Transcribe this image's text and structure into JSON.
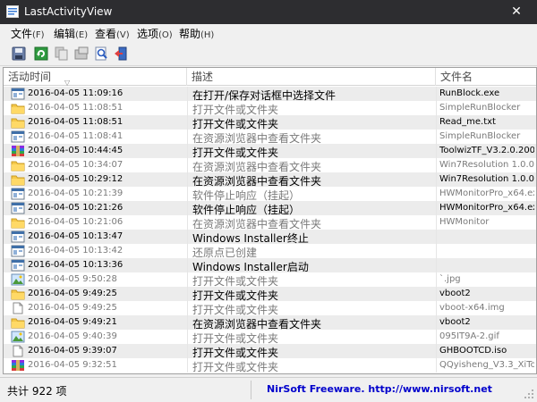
{
  "window": {
    "title": "LastActivityView",
    "close": "✕"
  },
  "menu": [
    {
      "label": "文件",
      "acc": "(F)"
    },
    {
      "label": "编辑",
      "acc": "(E)"
    },
    {
      "label": "查看",
      "acc": "(V)"
    },
    {
      "label": "选项",
      "acc": "(O)"
    },
    {
      "label": "帮助",
      "acc": "(H)"
    }
  ],
  "toolbar": {
    "buttons": [
      "save-icon",
      "refresh-icon",
      "copy-icon",
      "properties-icon",
      "find-icon",
      "exit-icon"
    ]
  },
  "columns": [
    "活动时间",
    "描述",
    "文件名"
  ],
  "rows": [
    {
      "icon": "window-icon",
      "time": "2016-04-05 11:09:16",
      "desc": "在打开/保存对话框中选择文件",
      "file": "RunBlock.exe",
      "bold": true
    },
    {
      "icon": "folder-icon",
      "time": "2016-04-05 11:08:51",
      "desc": "打开文件或文件夹",
      "file": "SimpleRunBlocker",
      "bold": false
    },
    {
      "icon": "folder-icon",
      "time": "2016-04-05 11:08:51",
      "desc": "打开文件或文件夹",
      "file": "Read_me.txt",
      "bold": true
    },
    {
      "icon": "window-icon",
      "time": "2016-04-05 11:08:41",
      "desc": "在资源浏览器中查看文件夹",
      "file": "SimpleRunBlocker",
      "bold": false
    },
    {
      "icon": "archive-icon",
      "time": "2016-04-05 10:44:45",
      "desc": "打开文件或文件夹",
      "file": "ToolwizTF_V3.2.0.200",
      "bold": true
    },
    {
      "icon": "folder-icon",
      "time": "2016-04-05 10:34:07",
      "desc": "在资源浏览器中查看文件夹",
      "file": "Win7Resolution 1.0.0",
      "bold": false
    },
    {
      "icon": "folder-icon",
      "time": "2016-04-05 10:29:12",
      "desc": "在资源浏览器中查看文件夹",
      "file": "Win7Resolution 1.0.0",
      "bold": true
    },
    {
      "icon": "window-icon",
      "time": "2016-04-05 10:21:39",
      "desc": "软件停止响应（挂起）",
      "file": "HWMonitorPro_x64.exe",
      "bold": false
    },
    {
      "icon": "window-icon",
      "time": "2016-04-05 10:21:26",
      "desc": "软件停止响应（挂起）",
      "file": "HWMonitorPro_x64.exe",
      "bold": true
    },
    {
      "icon": "folder-icon",
      "time": "2016-04-05 10:21:06",
      "desc": "在资源浏览器中查看文件夹",
      "file": "HWMonitor",
      "bold": false
    },
    {
      "icon": "window-icon",
      "time": "2016-04-05 10:13:47",
      "desc": "Windows Installer终止",
      "file": "",
      "bold": true
    },
    {
      "icon": "window-icon",
      "time": "2016-04-05 10:13:42",
      "desc": "还原点已创建",
      "file": "",
      "bold": false
    },
    {
      "icon": "window-icon",
      "time": "2016-04-05 10:13:36",
      "desc": "Windows Installer启动",
      "file": "",
      "bold": true
    },
    {
      "icon": "image-icon",
      "time": "2016-04-05 9:50:28",
      "desc": "打开文件或文件夹",
      "file": "`.jpg",
      "bold": false
    },
    {
      "icon": "folder-icon",
      "time": "2016-04-05 9:49:25",
      "desc": "打开文件或文件夹",
      "file": "vboot2",
      "bold": true
    },
    {
      "icon": "file-icon",
      "time": "2016-04-05 9:49:25",
      "desc": "打开文件或文件夹",
      "file": "vboot-x64.img",
      "bold": false
    },
    {
      "icon": "folder-icon",
      "time": "2016-04-05 9:49:21",
      "desc": "在资源浏览器中查看文件夹",
      "file": "vboot2",
      "bold": true
    },
    {
      "icon": "image-icon",
      "time": "2016-04-05 9:40:39",
      "desc": "打开文件或文件夹",
      "file": "095IT9A-2.gif",
      "bold": false
    },
    {
      "icon": "file-icon",
      "time": "2016-04-05 9:39:07",
      "desc": "打开文件或文件夹",
      "file": "GHBOOTCD.iso",
      "bold": true
    },
    {
      "icon": "archive-icon",
      "time": "2016-04-05 9:32:51",
      "desc": "打开文件或文件夹",
      "file": "QQyisheng_V3.3_XiTo",
      "bold": false
    }
  ],
  "status": {
    "count": "共计 922 项",
    "link": "NirSoft Freeware.  http://www.nirsoft.net"
  }
}
